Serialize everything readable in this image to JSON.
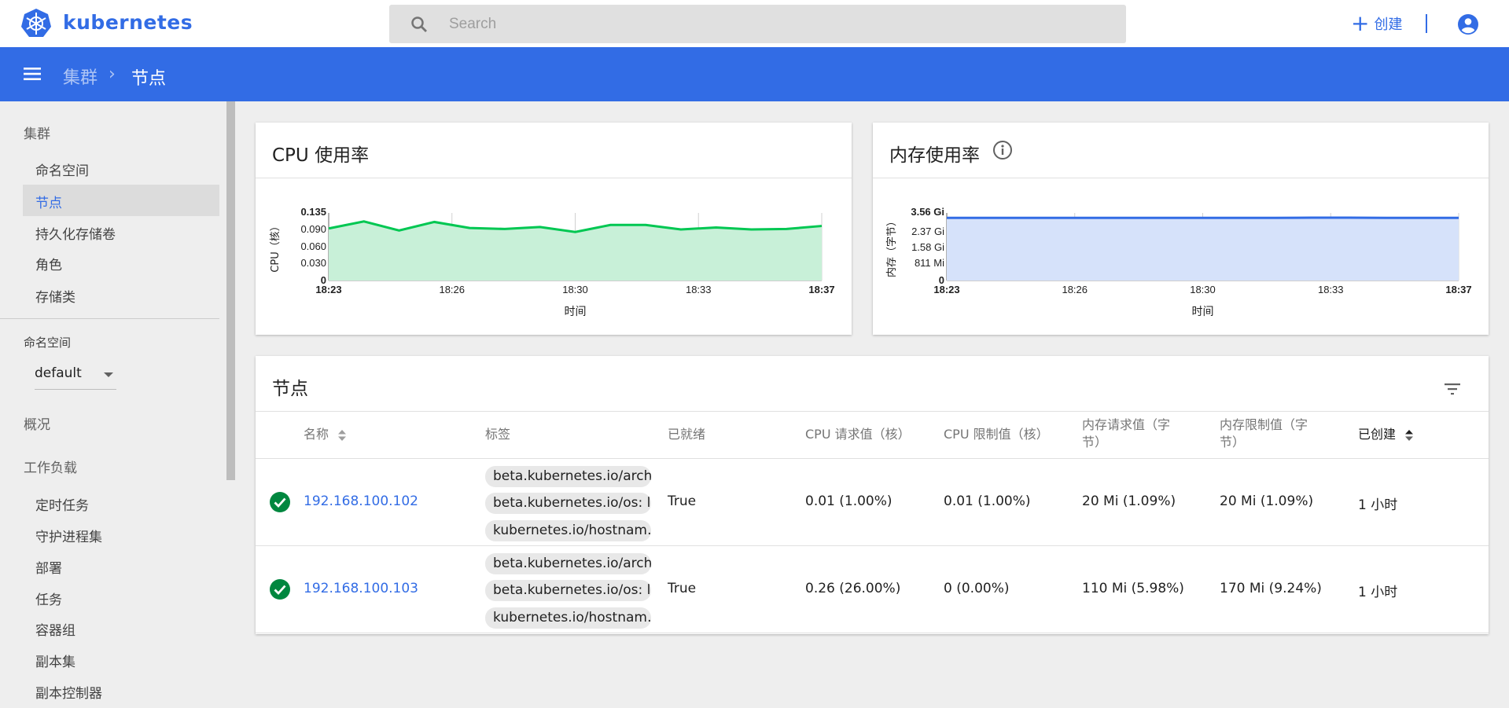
{
  "app": {
    "title": "kubernetes"
  },
  "search": {
    "placeholder": "Search"
  },
  "header": {
    "create_label": "创建"
  },
  "breadcrumb": {
    "parent": "集群",
    "separator": "›",
    "current": "节点"
  },
  "sidebar": {
    "cluster_heading": "集群",
    "cluster_items": [
      "命名空间",
      "节点",
      "持久化存储卷",
      "角色",
      "存储类"
    ],
    "namespace_label": "命名空间",
    "namespace_value": "default",
    "overview": "概况",
    "workloads_heading": "工作负载",
    "workload_items": [
      "定时任务",
      "守护进程集",
      "部署",
      "任务",
      "容器组",
      "副本集",
      "副本控制器"
    ]
  },
  "cpu_card": {
    "title": "CPU 使用率"
  },
  "mem_card": {
    "title": "内存使用率"
  },
  "chart_data": [
    {
      "type": "area",
      "title": "CPU 使用率",
      "xlabel": "时间",
      "ylabel": "CPU（核）",
      "x_ticks": [
        "18:23",
        "18:26",
        "18:30",
        "18:33",
        "18:37"
      ],
      "y_ticks": [
        "0",
        "0.030",
        "0.060",
        "0.090",
        "0.135"
      ],
      "ylim": [
        0,
        0.135
      ],
      "color": "#00c752",
      "fill": "#c8f0d8",
      "values": [
        0.104,
        0.118,
        0.1,
        0.117,
        0.105,
        0.103,
        0.107,
        0.097,
        0.111,
        0.111,
        0.102,
        0.106,
        0.102,
        0.103,
        0.109
      ]
    },
    {
      "type": "area",
      "title": "内存使用率",
      "xlabel": "时间",
      "ylabel": "内存（字节）",
      "x_ticks": [
        "18:23",
        "18:26",
        "18:30",
        "18:33",
        "18:37"
      ],
      "y_ticks": [
        "0",
        "811 Mi",
        "1.58 Gi",
        "2.37 Gi",
        "3.56 Gi"
      ],
      "ylim": [
        0,
        3.56
      ],
      "unit": "Gi",
      "color": "#326ce5",
      "fill": "#d6e2fa",
      "values": [
        3.3,
        3.3,
        3.3,
        3.3,
        3.3,
        3.3,
        3.3,
        3.3,
        3.3,
        3.3,
        3.31,
        3.31,
        3.3,
        3.3,
        3.3
      ]
    }
  ],
  "nodes_card": {
    "title": "节点",
    "columns": {
      "name": "名称",
      "labels": "标签",
      "ready": "已就绪",
      "cpu_req": "CPU 请求值（核）",
      "cpu_lim": "CPU 限制值（核）",
      "mem_req": "内存请求值（字节）",
      "mem_lim": "内存限制值（字节）",
      "created": "已创建"
    },
    "rows": [
      {
        "name": "192.168.100.102",
        "labels": [
          "beta.kubernetes.io/arch…",
          "beta.kubernetes.io/os: li…",
          "kubernetes.io/hostnam…"
        ],
        "ready": "True",
        "cpu_req": "0.01 (1.00%)",
        "cpu_lim": "0.01 (1.00%)",
        "mem_req": "20 Mi (1.09%)",
        "mem_lim": "20 Mi (1.09%)",
        "created": "1 小时"
      },
      {
        "name": "192.168.100.103",
        "labels": [
          "beta.kubernetes.io/arch…",
          "beta.kubernetes.io/os: li…",
          "kubernetes.io/hostnam…"
        ],
        "ready": "True",
        "cpu_req": "0.26 (26.00%)",
        "cpu_lim": "0 (0.00%)",
        "mem_req": "110 Mi (5.98%)",
        "mem_lim": "170 Mi (9.24%)",
        "created": "1 小时"
      }
    ]
  }
}
